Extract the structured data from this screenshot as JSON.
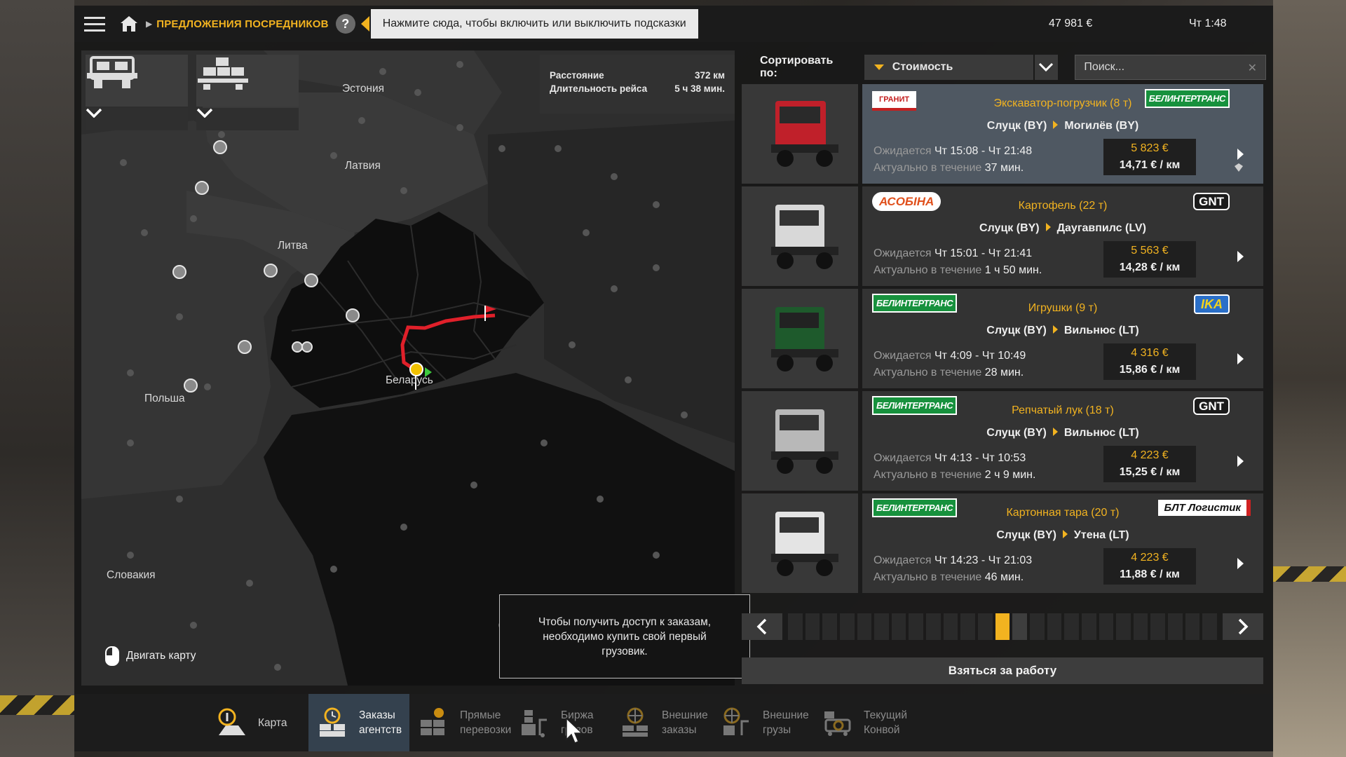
{
  "topbar": {
    "breadcrumb": "ПРЕДЛОЖЕНИЯ ПОСРЕДНИКОВ",
    "help_label": "?",
    "hint": "Нажмите сюда, чтобы включить или выключить подсказки",
    "money": "47 981 €",
    "time": "Чт 1:48"
  },
  "map": {
    "route_info": {
      "distance_label": "Расстояние",
      "distance_value": "372 км",
      "duration_label": "Длительность рейса",
      "duration_value": "5 ч 38 мин."
    },
    "labels": {
      "estonia": "Эстония",
      "latvia": "Латвия",
      "lithuania": "Литва",
      "belarus": "Беларусь",
      "poland": "Польша",
      "slovakia": "Словакия"
    },
    "move_map": "Двигать карту",
    "notice": "Чтобы получить доступ к заказам, необходимо купить свой первый грузовик."
  },
  "sort": {
    "label": "Сортировать по:",
    "selected": "Стоимость",
    "search_placeholder": "Поиск..."
  },
  "offers": [
    {
      "logo_left": "ГРАНИТ",
      "logo_right": "БЕЛИНТЕРТРАНС",
      "cargo": "Экскаватор-погрузчик (8 т)",
      "from": "Слуцк (BY)",
      "to": "Могилёв (BY)",
      "expected_label": "Ожидается",
      "expected": "Чт 15:08 - Чт 21:48",
      "valid_label": "Актуально в течение",
      "valid": "37 мин.",
      "price": "5 823 €",
      "per_km": "14,71 € / км"
    },
    {
      "logo_left": "АСОБІНА",
      "logo_right": "GNT",
      "cargo": "Картофель (22 т)",
      "from": "Слуцк (BY)",
      "to": "Даугавпилс (LV)",
      "expected_label": "Ожидается",
      "expected": "Чт 15:01 - Чт 21:41",
      "valid_label": "Актуально в течение",
      "valid": "1 ч 50 мин.",
      "price": "5 563 €",
      "per_km": "14,28 € / км"
    },
    {
      "logo_left": "БЕЛИНТЕРТРАНС",
      "logo_right": "IKA",
      "cargo": "Игрушки (9 т)",
      "from": "Слуцк (BY)",
      "to": "Вильнюс (LT)",
      "expected_label": "Ожидается",
      "expected": "Чт 4:09 - Чт 10:49",
      "valid_label": "Актуально в течение",
      "valid": "28 мин.",
      "price": "4 316 €",
      "per_km": "15,86 € / км"
    },
    {
      "logo_left": "БЕЛИНТЕРТРАНС",
      "logo_right": "GNT",
      "cargo": "Репчатый лук (18 т)",
      "from": "Слуцк (BY)",
      "to": "Вильнюс (LT)",
      "expected_label": "Ожидается",
      "expected": "Чт 4:13 - Чт 10:53",
      "valid_label": "Актуально в течение",
      "valid": "2 ч 9 мин.",
      "price": "4 223 €",
      "per_km": "15,25 € / км"
    },
    {
      "logo_left": "БЕЛИНТЕРТРАНС",
      "logo_right": "БЛТ Логистик",
      "cargo": "Картонная тара (20 т)",
      "from": "Слуцк (BY)",
      "to": "Утена (LT)",
      "expected_label": "Ожидается",
      "expected": "Чт 14:23 - Чт 21:03",
      "valid_label": "Актуально в течение",
      "valid": "46 мин.",
      "price": "4 223 €",
      "per_km": "11,88 € / км"
    }
  ],
  "take_job": "Взяться за работу",
  "tabs": [
    {
      "line1": "Карта",
      "line2": ""
    },
    {
      "line1": "Заказы",
      "line2": "агентств"
    },
    {
      "line1": "Прямые",
      "line2": "перевозки"
    },
    {
      "line1": "Биржа",
      "line2": "грузов"
    },
    {
      "line1": "Внешние",
      "line2": "заказы"
    },
    {
      "line1": "Внешние",
      "line2": "грузы"
    },
    {
      "line1": "Текущий",
      "line2": "Конвой"
    }
  ],
  "colors": {
    "accent": "#f2b320",
    "route": "#e0202a",
    "selected_offer": "#4f5862",
    "active_tab": "#34414e"
  }
}
